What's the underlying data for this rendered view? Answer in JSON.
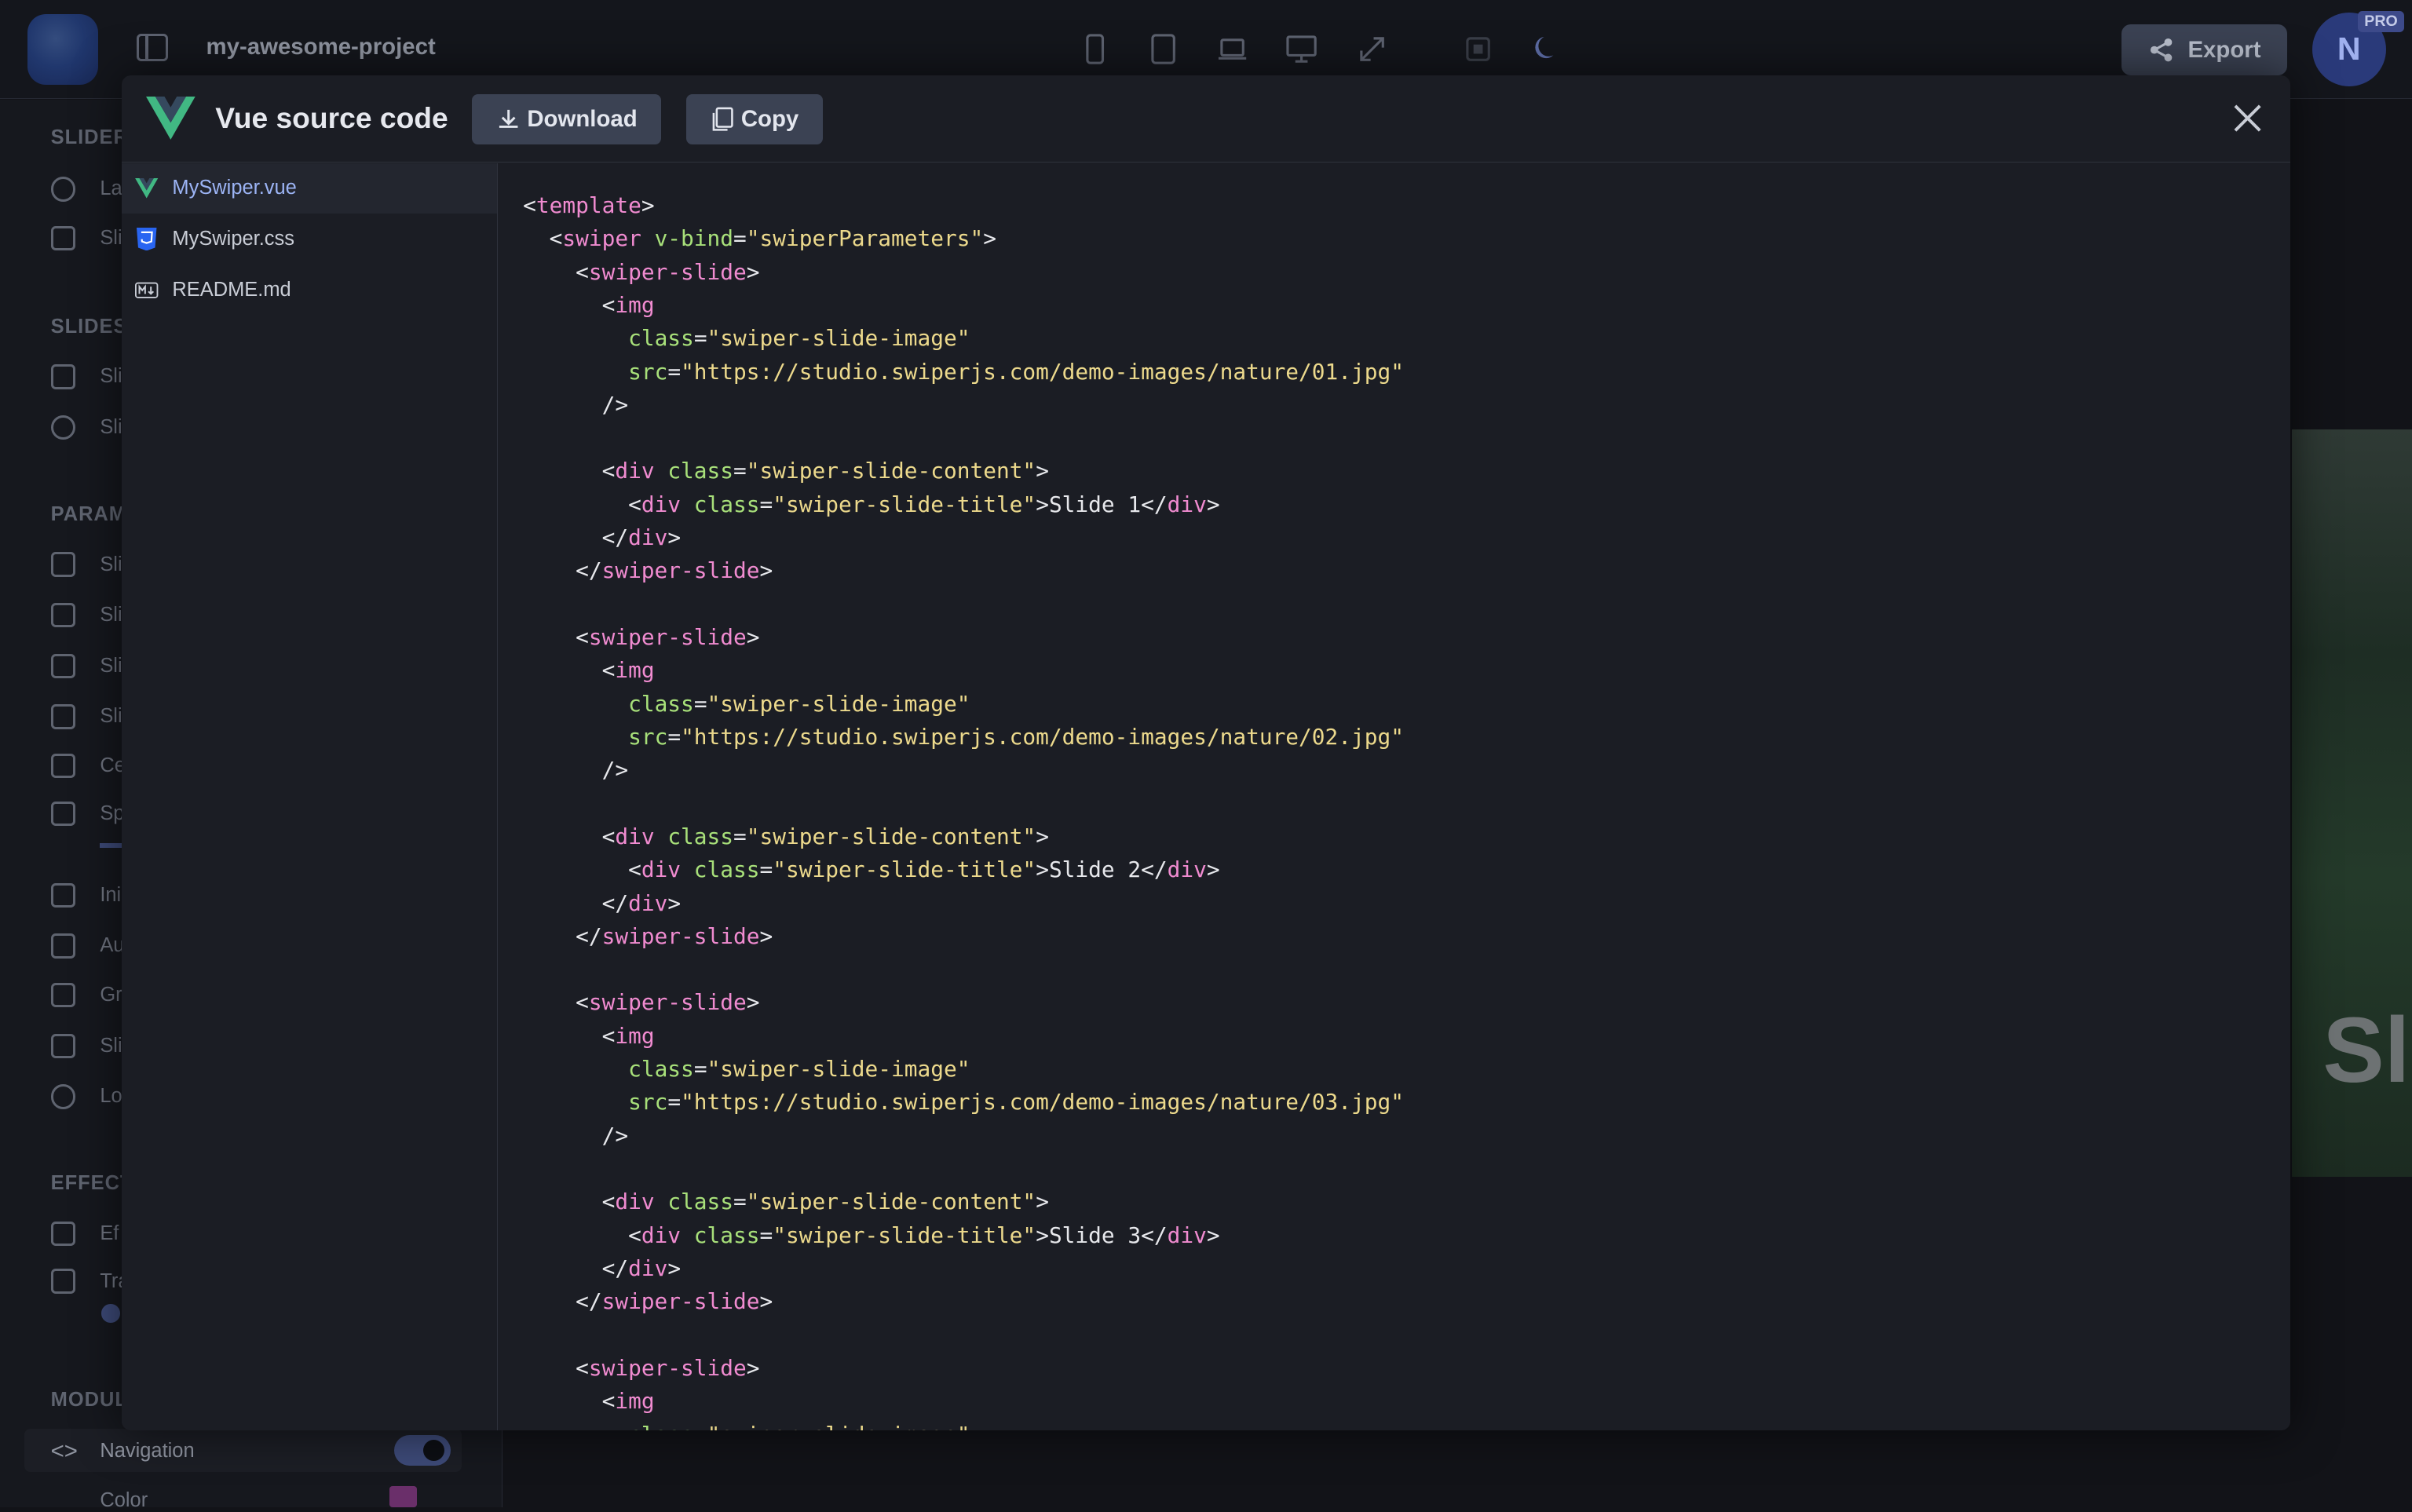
{
  "app": {
    "project_name": "my-awesome-project",
    "export_label": "Export",
    "avatar_initial": "N",
    "pro_badge": "PRO",
    "device_icons": [
      "phone-icon",
      "tablet-icon",
      "laptop-icon",
      "desktop-icon",
      "expand-icon",
      "frame-icon",
      "moon-icon"
    ]
  },
  "left_panel": {
    "sections": [
      "SLIDER",
      "SLIDES",
      "PARAM",
      "EFFECT",
      "MODUL"
    ],
    "items": [
      "La",
      "Sli",
      "Sli",
      "Sli",
      "Sli",
      "Sli",
      "Sli",
      "Sli",
      "Ce",
      "Sp",
      "Ini",
      "Au",
      "Gr",
      "Sli",
      "Lo",
      "Ef",
      "Tra"
    ],
    "navigation_label": "Navigation",
    "color_label": "Color"
  },
  "preview": {
    "visible_text": "Sl"
  },
  "modal": {
    "title": "Vue source code",
    "download_label": "Download",
    "copy_label": "Copy",
    "files": [
      {
        "name": "MySwiper.vue",
        "icon": "vue-icon",
        "active": true
      },
      {
        "name": "MySwiper.css",
        "icon": "css-icon",
        "active": false
      },
      {
        "name": "README.md",
        "icon": "markdown-icon",
        "active": false
      }
    ],
    "code": {
      "template_open": "template",
      "swiper_tag": "swiper",
      "swiper_attr": "v-bind",
      "swiper_attr_value": "\"swiperParameters\"",
      "slides": [
        {
          "img_src": "\"https://studio.swiperjs.com/demo-images/nature/01.jpg\"",
          "title": "Slide 1"
        },
        {
          "img_src": "\"https://studio.swiperjs.com/demo-images/nature/02.jpg\"",
          "title": "Slide 2"
        },
        {
          "img_src": "\"https://studio.swiperjs.com/demo-images/nature/03.jpg\"",
          "title": "Slide 3"
        }
      ],
      "slide_tag": "swiper-slide",
      "img_tag": "img",
      "div_tag": "div",
      "class_attr": "class",
      "src_attr": "src",
      "img_class_value": "\"swiper-slide-image\"",
      "content_class_value": "\"swiper-slide-content\"",
      "title_class_value": "\"swiper-slide-title\""
    }
  },
  "colors": {
    "tag": "#f08bd0",
    "attribute": "#a8e07a",
    "string": "#ecd98c",
    "active_file": "#9cb4f5"
  }
}
